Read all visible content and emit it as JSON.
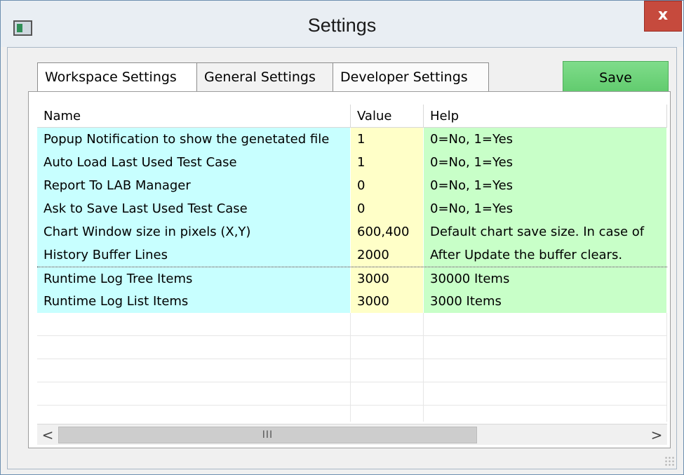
{
  "window": {
    "title": "Settings",
    "close_label": "x"
  },
  "tabs": [
    {
      "label": "Workspace Settings",
      "selected": true
    },
    {
      "label": "General Settings",
      "selected": false
    },
    {
      "label": "Developer Settings",
      "selected": false
    }
  ],
  "save_label": "Save",
  "grid": {
    "columns": [
      "Name",
      "Value",
      "Help"
    ],
    "rows": [
      {
        "name": "Popup Notification to show the genetated file",
        "value": "1",
        "help": "0=No, 1=Yes"
      },
      {
        "name": "Auto Load Last Used Test Case",
        "value": "1",
        "help": "0=No, 1=Yes"
      },
      {
        "name": "Report To LAB Manager",
        "value": "0",
        "help": "0=No, 1=Yes"
      },
      {
        "name": "Ask to Save Last Used Test Case",
        "value": "0",
        "help": "0=No, 1=Yes"
      },
      {
        "name": "Chart Window size in pixels (X,Y)",
        "value": "600,400",
        "help": "Default chart save size. In case of"
      },
      {
        "name": "History Buffer Lines",
        "value": "2000",
        "help": "After Update the buffer clears."
      },
      {
        "name": "Runtime Log Tree Items",
        "value": "3000",
        "help": "30000 Items"
      },
      {
        "name": "Runtime Log List Items",
        "value": "3000",
        "help": "3000 Items"
      }
    ]
  },
  "scrollbar": {
    "left_arrow": "<",
    "right_arrow": ">",
    "grip": "III"
  },
  "colors": {
    "name_cell": "#c8ffff",
    "value_cell": "#ffffc8",
    "help_cell": "#c8ffc8",
    "save_button": "#6fd37b",
    "close_button": "#c64a3d"
  }
}
